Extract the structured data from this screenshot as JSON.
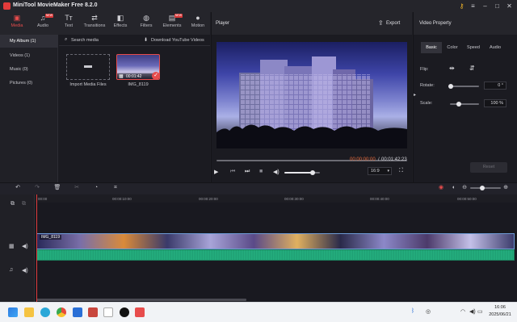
{
  "window": {
    "title": "MiniTool MovieMaker Free 8.2.0"
  },
  "toolbar": {
    "items": [
      {
        "label": "Media",
        "icon": "folder-icon",
        "active": true
      },
      {
        "label": "Audio",
        "icon": "music-note-icon",
        "badge": "NEW"
      },
      {
        "label": "Text",
        "icon": "text-icon"
      },
      {
        "label": "Transitions",
        "icon": "swap-arrows-icon"
      },
      {
        "label": "Effects",
        "icon": "effects-icon"
      },
      {
        "label": "Filters",
        "icon": "filter-icon"
      },
      {
        "label": "Elements",
        "icon": "elements-icon",
        "badge": "NEW"
      },
      {
        "label": "Motion",
        "icon": "motion-icon"
      }
    ]
  },
  "library": {
    "sidebar": [
      {
        "label": "My Album (1)",
        "selected": true
      },
      {
        "label": "Videos (1)"
      },
      {
        "label": "Music (0)"
      },
      {
        "label": "Pictures (0)"
      }
    ],
    "search_placeholder": "Search media",
    "download_label": "Download YouTube Videos",
    "import_label": "Import Media Files",
    "clip": {
      "name": "IMG_8119",
      "duration": "00:01:42"
    }
  },
  "player": {
    "title": "Player",
    "export_label": "Export",
    "current_time": "00:00:00:00",
    "separator": "/",
    "total_time": "00:01:42:23",
    "aspect": "16:9",
    "volume_level": 0.8
  },
  "property": {
    "title": "Video Property",
    "tabs": [
      "Basic",
      "Color",
      "Speed",
      "Audio"
    ],
    "flip_label": "Flip:",
    "rotate_label": "Rotate:",
    "rotate_value": "0 °",
    "scale_label": "Scale:",
    "scale_value": "100 %",
    "ok_label": "Reset"
  },
  "timeline": {
    "ticks": [
      "00:00",
      "00:00:10:00",
      "00:00:20:00",
      "00:00:30:00",
      "00:00:40:00",
      "00:00:50:00"
    ],
    "clip_label": "IMG_8119"
  },
  "taskbar": {
    "time": "16:06",
    "date": "2025/06/21"
  },
  "colors": {
    "accent": "#e74c4c",
    "waveform": "#22a87a",
    "clip_border": "#6e9bd6"
  }
}
